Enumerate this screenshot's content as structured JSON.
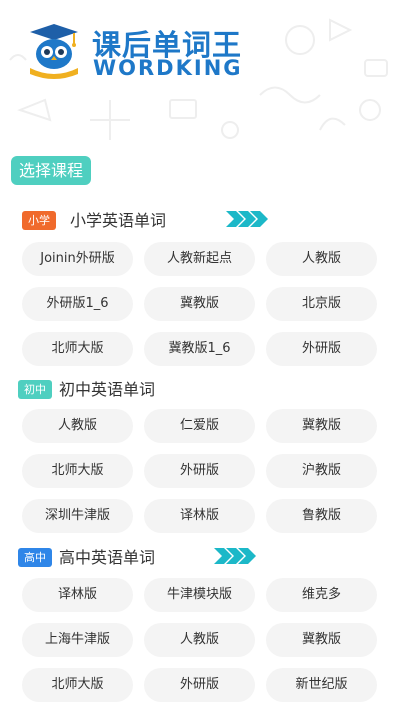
{
  "header": {
    "title": "课后单词王",
    "subtitle": "WORDKING",
    "logo_icon": "owl-book-logo-icon"
  },
  "choose_label": "选择课程",
  "colors": {
    "brand_blue": "#1e78c8",
    "teal": "#4fcfc0",
    "primary_badge": "#f06a2c",
    "middle_badge": "#4fcfc0",
    "high_badge": "#2f86e8",
    "arrow": "#1cb8c8",
    "chip_bg": "#f4f4f4"
  },
  "sections": [
    {
      "badge": "小学",
      "title": "小学英语单词",
      "has_more_arrows": true,
      "items": [
        "Joinin外研版",
        "人教新起点",
        "人教版",
        "外研版1_6",
        "冀教版",
        "北京版",
        "北师大版",
        "冀教版1_6",
        "外研版"
      ]
    },
    {
      "badge": "初中",
      "title": "初中英语单词",
      "has_more_arrows": false,
      "items": [
        "人教版",
        "仁爱版",
        "冀教版",
        "北师大版",
        "外研版",
        "沪教版",
        "深圳牛津版",
        "译林版",
        "鲁教版"
      ]
    },
    {
      "badge": "高中",
      "title": "高中英语单词",
      "has_more_arrows": true,
      "items": [
        "译林版",
        "牛津模块版",
        "维克多",
        "上海牛津版",
        "人教版",
        "冀教版",
        "北师大版",
        "外研版",
        "新世纪版"
      ]
    }
  ]
}
